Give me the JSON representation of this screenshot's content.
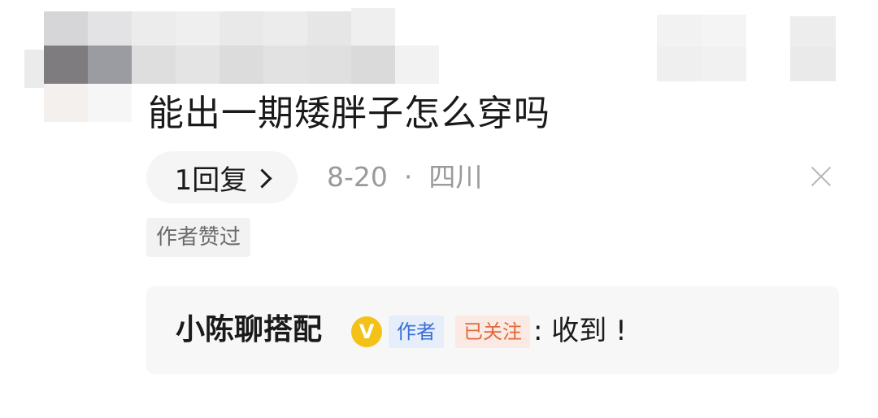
{
  "comment": {
    "text": "能出一期矮胖子怎么穿吗",
    "reply_count_label": "1回复",
    "date": "8-20",
    "separator": "·",
    "location": "四川",
    "liked_badge": "作者赞过"
  },
  "reply": {
    "author_name": "小陈聊搭配",
    "verified_icon": "V",
    "author_tag": "作者",
    "follow_tag": "已关注",
    "text": ": 收到 !"
  },
  "icons": {
    "close": "close-icon",
    "chevron": "chevron-right-icon",
    "verified": "verified-badge-icon"
  },
  "colors": {
    "verified": "#f3c118",
    "author_tag_text": "#3b6fd4",
    "follow_tag_text": "#e06a3c",
    "meta_text": "#9a9a9a"
  }
}
